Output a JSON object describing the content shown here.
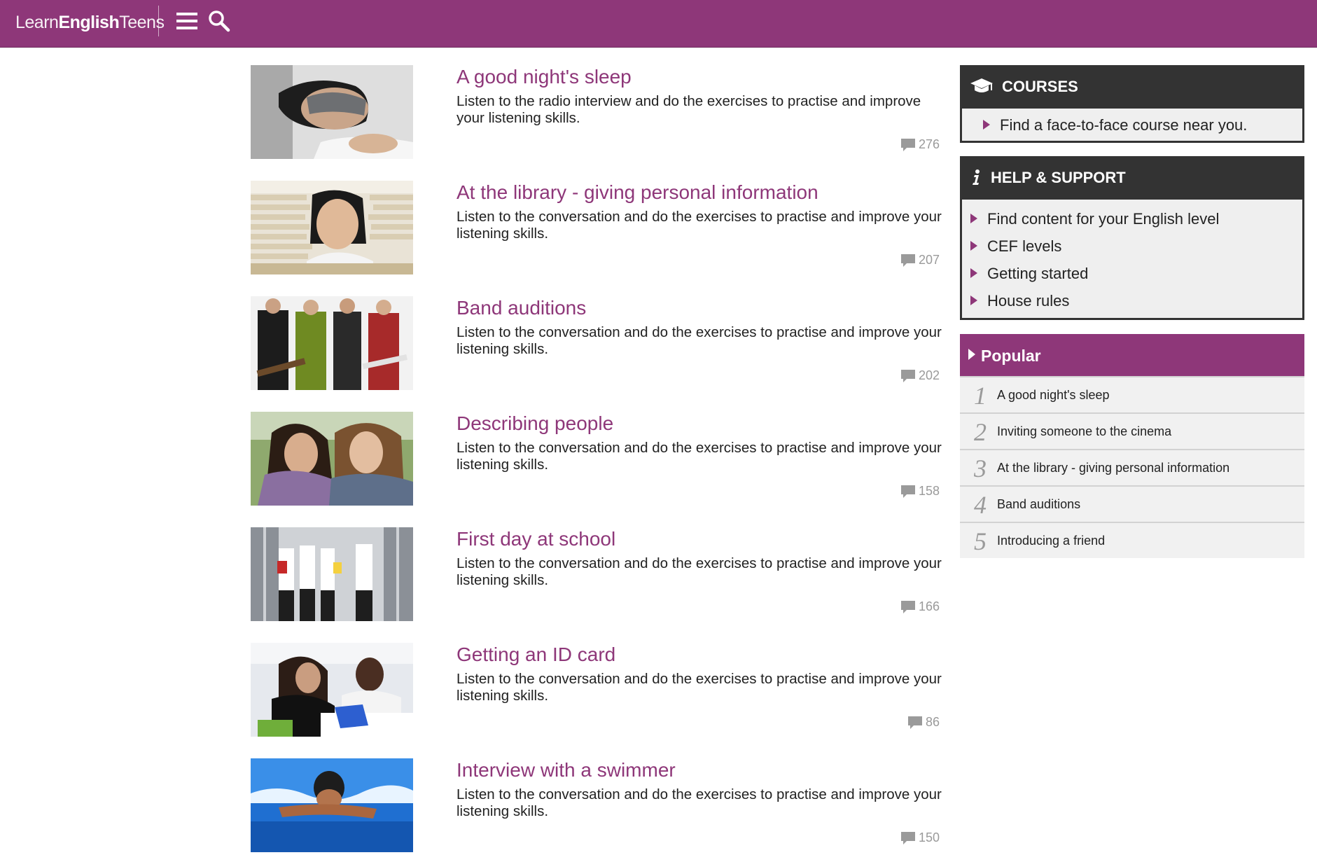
{
  "header": {
    "logo": {
      "part1": "Learn",
      "part2": "English",
      "part3": "Teens"
    },
    "menu_icon": "hamburger-menu-icon",
    "search_icon": "search-icon",
    "bg_color": "#8e3779"
  },
  "articles": [
    {
      "title": "A good night's sleep",
      "description": "Listen to the radio interview and do the exercises to practise and improve your listening skills.",
      "comments": "276",
      "image": "sleeping-girl-with-eye-mask"
    },
    {
      "title": "At the library - giving personal information",
      "description": "Listen to the conversation and do the exercises to practise and improve your listening skills.",
      "comments": "207",
      "image": "girl-behind-stack-of-books"
    },
    {
      "title": "Band auditions",
      "description": "Listen to the conversation and do the exercises to practise and improve your listening skills.",
      "comments": "202",
      "image": "four-teen-band-members"
    },
    {
      "title": "Describing people",
      "description": "Listen to the conversation and do the exercises to practise and improve your listening skills.",
      "comments": "158",
      "image": "two-girls-chatting-outdoors"
    },
    {
      "title": "First day at school",
      "description": "Listen to the conversation and do the exercises to practise and improve your listening skills.",
      "comments": "166",
      "image": "students-in-school-corridor"
    },
    {
      "title": "Getting an ID card",
      "description": "Listen to the conversation and do the exercises to practise and improve your listening skills.",
      "comments": "86",
      "image": "woman-and-man-at-desk-with-laptop"
    },
    {
      "title": "Interview with a swimmer",
      "description": "Listen to the conversation and do the exercises to practise and improve your listening skills.",
      "comments": "150",
      "image": "swimmer-in-pool"
    }
  ],
  "sidebar": {
    "courses": {
      "title": "COURSES",
      "icon": "graduation-cap-icon",
      "links": [
        "Find a face-to-face course near you."
      ]
    },
    "help": {
      "title": "HELP & SUPPORT",
      "icon": "info-icon",
      "links": [
        "Find content for your English level",
        "CEF levels",
        "Getting started",
        "House rules"
      ]
    },
    "popular": {
      "title": "Popular",
      "items": [
        {
          "num": "1",
          "label": "A good night's sleep"
        },
        {
          "num": "2",
          "label": "Inviting someone to the cinema"
        },
        {
          "num": "3",
          "label": "At the library - giving personal information"
        },
        {
          "num": "4",
          "label": "Band auditions"
        },
        {
          "num": "5",
          "label": "Introducing a friend"
        }
      ]
    }
  },
  "colors": {
    "accent": "#8e3779",
    "dark": "#333333",
    "muted": "#9a9a9a"
  }
}
